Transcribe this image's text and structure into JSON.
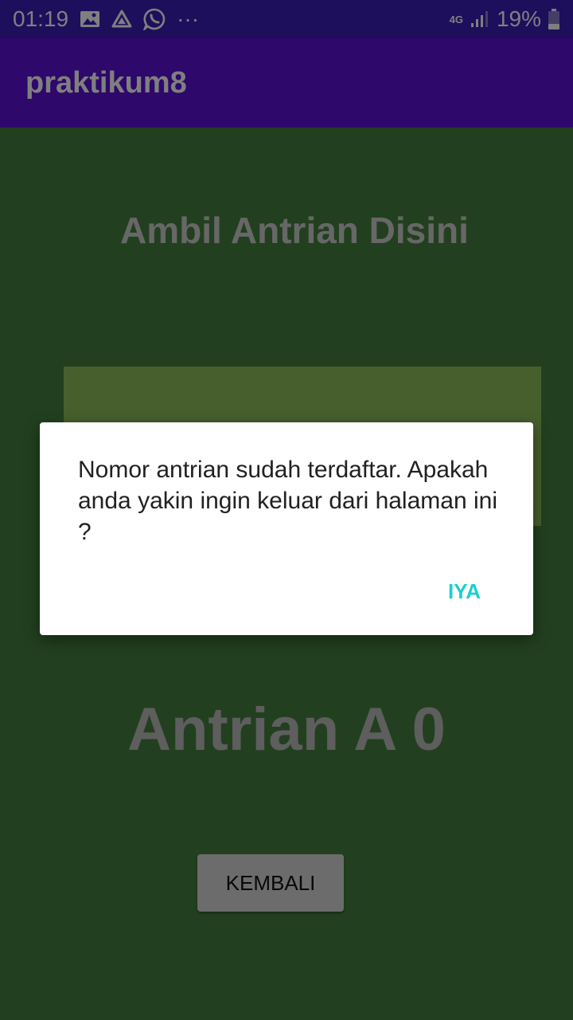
{
  "status_bar": {
    "time": "01:19",
    "more": "···",
    "network": "4G",
    "battery": "19%",
    "icons": [
      "image-icon",
      "drive-icon",
      "whatsapp-icon",
      "signal-icon",
      "battery-icon"
    ]
  },
  "app_bar": {
    "title": "praktikum8",
    "color": "#5c10d6"
  },
  "main": {
    "heading": "Ambil Antrian Disini",
    "queue_label": "Antrian A 0",
    "back_button": "KEMBALI",
    "background_color": "#45803f"
  },
  "dialog": {
    "message": "Nomor antrian sudah terdaftar. Apakah anda yakin ingin keluar dari halaman ini ?",
    "confirm_button": "IYA",
    "accent_color": "#1ccfcf"
  }
}
